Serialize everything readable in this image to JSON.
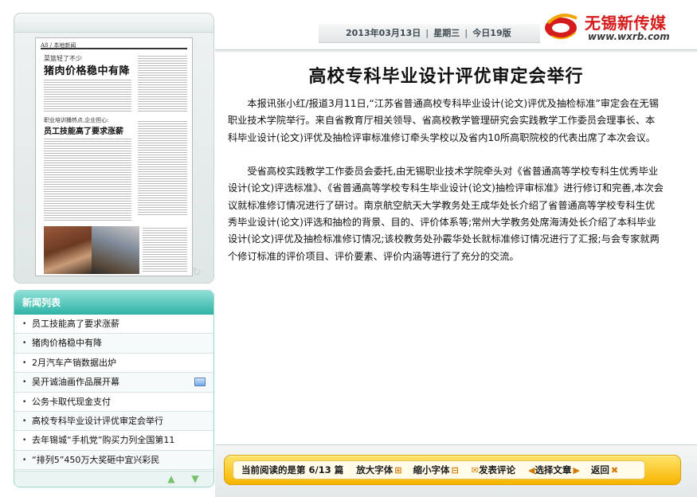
{
  "header": {
    "date": "2013年03月13日",
    "weekday": "星期三",
    "edition": "今日19版",
    "separator": "|"
  },
  "logo": {
    "title": "无锡新传媒",
    "url": "www.wxrb.com",
    "brand_color": "#d41c1c"
  },
  "thumbnail": {
    "header_left": "A8 / 本地新闻",
    "kicker": "菜篮轻了不少",
    "headline": "猪肉价格稳中有降",
    "kicker2": "职业培训播热点,企业担心:",
    "headline2": "员工技能高了要求涨薪",
    "refresh_icon": "refresh-icon"
  },
  "news_list": {
    "title": "新闻列表",
    "bullet": "•",
    "items": [
      {
        "label": "员工技能高了要求涨薪",
        "has_picture": false
      },
      {
        "label": "猪肉价格稳中有降",
        "has_picture": false
      },
      {
        "label": "2月汽车产销数据出炉",
        "has_picture": false
      },
      {
        "label": "吴开诚油画作品展开幕",
        "has_picture": true
      },
      {
        "label": "公务卡取代现金支付",
        "has_picture": false
      },
      {
        "label": "高校专科毕业设计评优审定会举行",
        "has_picture": false
      },
      {
        "label": "去年锡城“手机党”购买力列全国第11",
        "has_picture": false
      },
      {
        "label": "“排列5”450万大奖砸中宜兴彩民",
        "has_picture": false
      }
    ],
    "up_icon": "arrow-up-icon",
    "down_icon": "arrow-down-icon"
  },
  "article": {
    "title": "高校专科毕业设计评优审定会举行",
    "paragraphs": [
      "本报讯张小红/报道3月11日,“江苏省普通高校专科毕业设计(论文)评优及抽检标准”审定会在无锡职业技术学院举行。来自省教育厅相关领导、省高校教学管理研究会实践教学工作委员会理事长、本科毕业设计(论文)评优及抽检评审标准修订牵头学校以及省内10所高职院校的代表出席了本次会议。",
      "受省高校实践教学工作委员会委托,由无锡职业技术学院牵头对《省普通高等学校专科生优秀毕业设计(论文)评选标准》、《省普通高等学校专科生毕业设计(论文)抽检评审标准》进行修订和完善,本次会议就标准修订情况进行了研讨。南京航空航天大学教务处王成华处长介绍了省普通高等学校专科生优秀毕业设计(论文)评选和抽检的背景、目的、评价体系等;常州大学教务处席海涛处长介绍了本科毕业设计(论文)评优及抽检标准修订情况;该校教务处孙霰华处长就标准修订情况进行了汇报;与会专家就两个修订标准的评价项目、评价要素、评价内涵等进行了充分的交流。"
    ]
  },
  "toolbar": {
    "reading_prefix": "当前阅读的是第",
    "reading_position": "6/13",
    "reading_suffix": "篇",
    "enlarge_font": "放大字体",
    "shrink_font": "缩小字体",
    "comment": "发表评论",
    "select_article": "选择文章",
    "back": "返回",
    "accent_color": "#f7b500"
  }
}
